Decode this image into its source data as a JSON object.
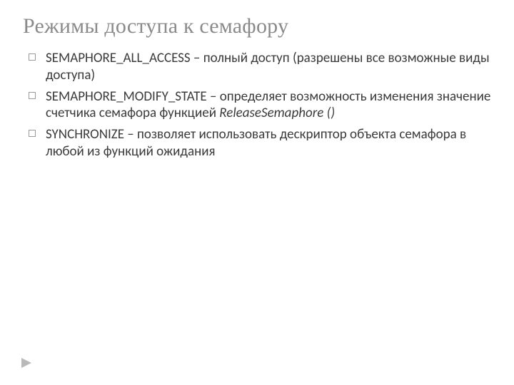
{
  "title": "Режимы доступа к семафору",
  "bullets": [
    {
      "const": "SEMAPHORE_ALL_ACCESS",
      "text": " – полный доступ (разрешены все возможные виды доступа)"
    },
    {
      "const": "SEMAPHORE_MODIFY_STATE",
      "text": " – определяет возможность изменения значение счетчика семафора функцией ",
      "func": "ReleaseSemaphore ()"
    },
    {
      "const": "SYNCHRONIZE",
      "text": " – позволяет использовать дескриптор объекта семафора в любой из функций ожидания"
    }
  ]
}
